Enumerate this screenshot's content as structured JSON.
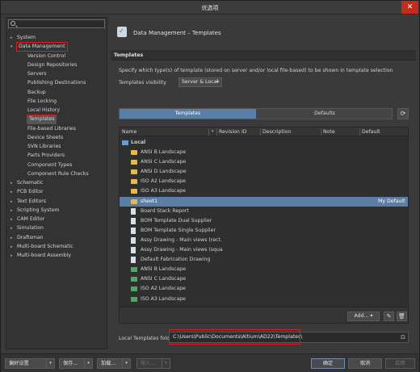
{
  "window": {
    "title": "优选项",
    "close_glyph": "✕"
  },
  "search": {
    "placeholder": ""
  },
  "tree": [
    {
      "label": "System",
      "exp": "▸"
    },
    {
      "label": "Data Management",
      "exp": "▾"
    },
    {
      "label": "Version Control"
    },
    {
      "label": "Design Repositories"
    },
    {
      "label": "Servers"
    },
    {
      "label": "Publishing Destinations"
    },
    {
      "label": "Backup"
    },
    {
      "label": "File Locking"
    },
    {
      "label": "Local History"
    },
    {
      "label": "Templates"
    },
    {
      "label": "File-based Libraries"
    },
    {
      "label": "Device Sheets"
    },
    {
      "label": "SVN Libraries"
    },
    {
      "label": "Parts Providers"
    },
    {
      "label": "Component Types"
    },
    {
      "label": "Component Rule Checks"
    },
    {
      "label": "Schematic",
      "exp": "▸"
    },
    {
      "label": "PCB Editor",
      "exp": "▸"
    },
    {
      "label": "Text Editors",
      "exp": "▸"
    },
    {
      "label": "Scripting System",
      "exp": "▸"
    },
    {
      "label": "CAM Editor",
      "exp": "▸"
    },
    {
      "label": "Simulation",
      "exp": "▸"
    },
    {
      "label": "Draftsman",
      "exp": "▸"
    },
    {
      "label": "Multi-board Schematic",
      "exp": "▸"
    },
    {
      "label": "Multi-board Assembly",
      "exp": "▸"
    }
  ],
  "page": {
    "title": "Data Management – Templates",
    "section": "Templates",
    "description": "Specify which type(s) of template (stored on server and/or local file-based) to be shown in template selection",
    "visibility_label": "Templates visibility",
    "visibility_value": "Server & Local",
    "tab_templates": "Templates",
    "tab_defaults": "Defaults",
    "refresh_glyph": "⟳"
  },
  "grid": {
    "columns": [
      "Name",
      "Revision ID",
      "Description",
      "Note",
      "Default"
    ],
    "group": "Local",
    "rows": [
      {
        "name": "ANSI B Landscape",
        "icon": "fold"
      },
      {
        "name": "ANSI C Landscape",
        "icon": "fold"
      },
      {
        "name": "ANSI D Landscape",
        "icon": "fold"
      },
      {
        "name": "ISO A2 Landscape",
        "icon": "fold"
      },
      {
        "name": "ISO A3 Landscape",
        "icon": "fold"
      },
      {
        "name": "sheet1",
        "icon": "fold",
        "default": "My Default",
        "selected": true
      },
      {
        "name": "Board Stack Report",
        "icon": "doc"
      },
      {
        "name": "BOM Template Dual Supplier",
        "icon": "doc"
      },
      {
        "name": "BOM Template Single Supplier",
        "icon": "doc"
      },
      {
        "name": "Assy Drawing - Main views (rect.",
        "icon": "doc"
      },
      {
        "name": "Assy Drawing - Main views (squa",
        "icon": "doc"
      },
      {
        "name": "Default Fabrication Drawing",
        "icon": "doc"
      },
      {
        "name": "ANSI B Landscape",
        "icon": "pcb"
      },
      {
        "name": "ANSI C Landscape",
        "icon": "pcb"
      },
      {
        "name": "ISO A2 Landscape",
        "icon": "pcb"
      },
      {
        "name": "ISO A3 Landscape",
        "icon": "pcb"
      }
    ],
    "add_label": "Add...",
    "edit_glyph": "✎",
    "delete_glyph": "🗑"
  },
  "local_folder": {
    "label": "Local Templates folder",
    "value": "C:\\Users\\Public\\Documents\\Altium\\AD22\\Templates\\"
  },
  "footer": {
    "set_label": "偏好设置",
    "save_label": "保存...",
    "load_label": "加载...",
    "import_label": "导入...",
    "ok_label": "确定",
    "cancel_label": "取消",
    "apply_label": "应用"
  },
  "colors": {
    "accent": "#5a7ea6",
    "highlight": "#e0191f"
  }
}
